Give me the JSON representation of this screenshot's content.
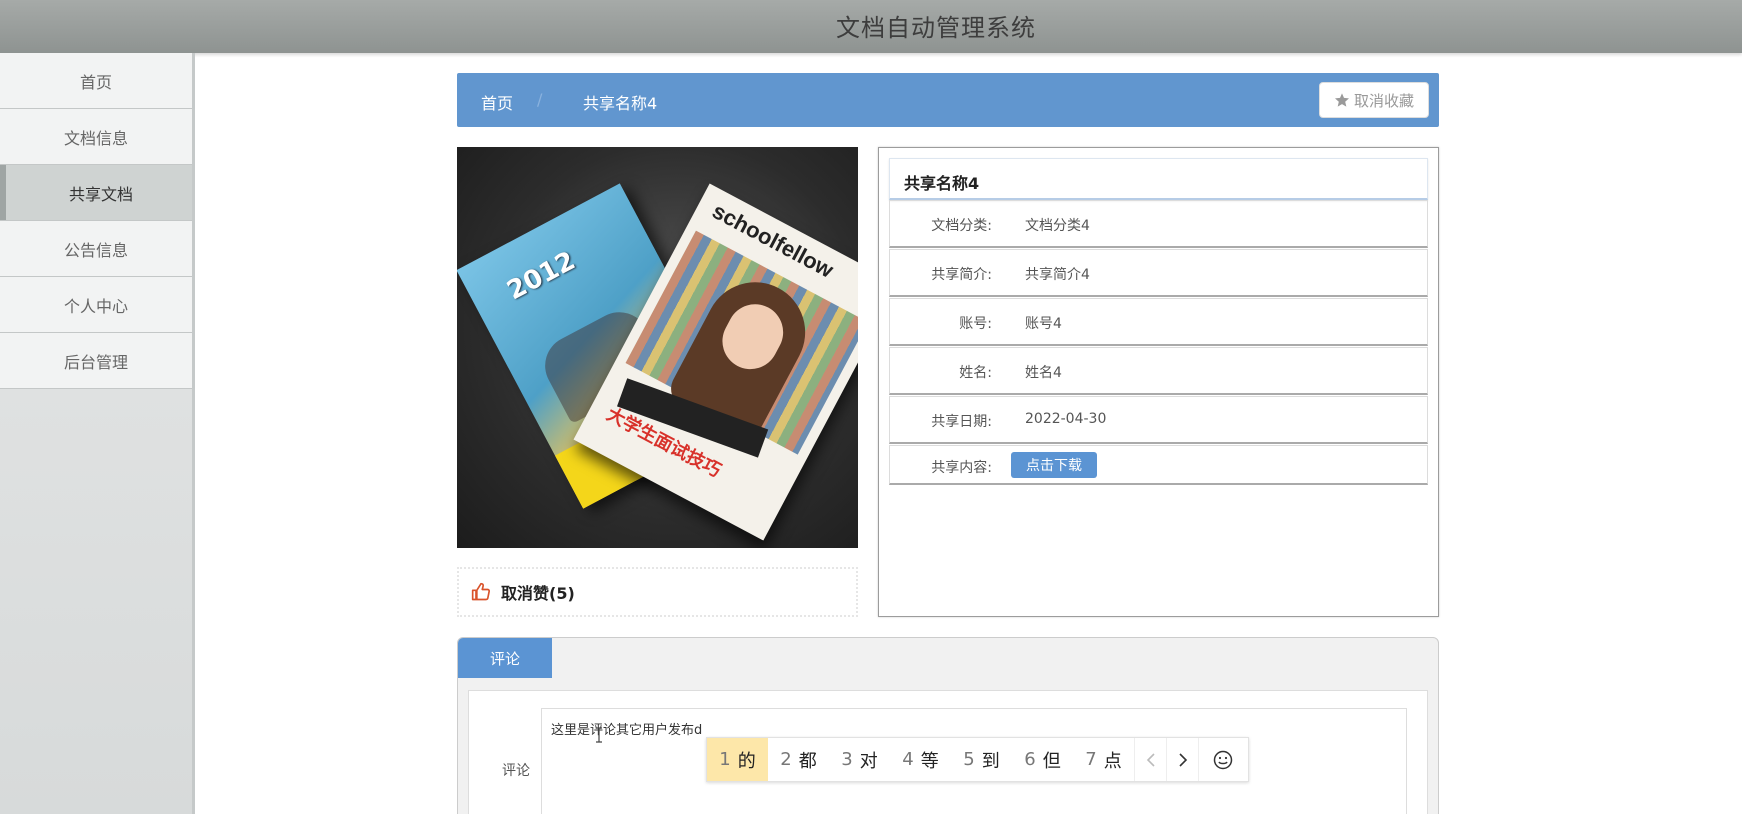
{
  "header": {
    "title": "文档自动管理系统"
  },
  "sidebar": {
    "items": [
      {
        "label": "首页"
      },
      {
        "label": "文档信息"
      },
      {
        "label": "共享文档"
      },
      {
        "label": "公告信息"
      },
      {
        "label": "个人中心"
      },
      {
        "label": "后台管理"
      }
    ],
    "active": "共享文档"
  },
  "breadcrumb": {
    "home": "首页",
    "separator": "/",
    "current": "共享名称4"
  },
  "favorite": {
    "label": "取消收藏",
    "icon": "star-icon"
  },
  "like": {
    "label": "取消赞(5)",
    "icon": "thumbs-up-icon",
    "color": "#d9532b"
  },
  "cover": {
    "magazine_left_text": "2012",
    "magazine_right_title": "schoolfellow",
    "magazine_right_caption": "大学生面试技巧"
  },
  "detail": {
    "title": "共享名称4",
    "rows": [
      {
        "key": "文档分类:",
        "value": "文档分类4"
      },
      {
        "key": "共享简介:",
        "value": "共享简介4"
      },
      {
        "key": "账号:",
        "value": "账号4"
      },
      {
        "key": "姓名:",
        "value": "姓名4"
      },
      {
        "key": "共享日期:",
        "value": "2022-04-30"
      }
    ],
    "download": {
      "key": "共享内容:",
      "button": "点击下载"
    }
  },
  "comments": {
    "tab": "评论",
    "field_label": "评论",
    "text": "这里是评论其它用户发布d"
  },
  "ime": {
    "candidates": [
      {
        "n": "1",
        "w": "的"
      },
      {
        "n": "2",
        "w": "都"
      },
      {
        "n": "3",
        "w": "对"
      },
      {
        "n": "4",
        "w": "等"
      },
      {
        "n": "5",
        "w": "到"
      },
      {
        "n": "6",
        "w": "但"
      },
      {
        "n": "7",
        "w": "点"
      }
    ],
    "prev_icon": "chevron-left-icon",
    "next_icon": "chevron-right-icon",
    "emoji_icon": "smiley-icon"
  },
  "colors": {
    "accent": "#6196cf",
    "button": "#5b94d3",
    "header": "#999d9b"
  }
}
